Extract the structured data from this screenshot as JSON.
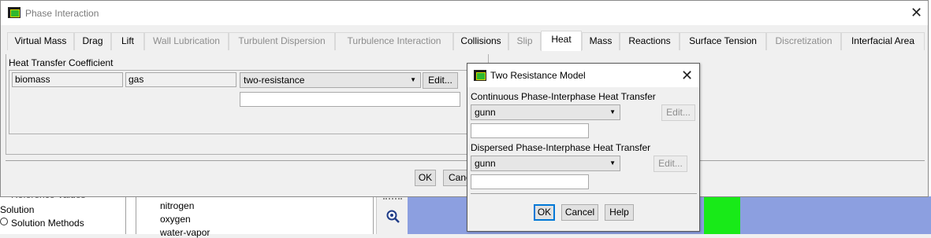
{
  "background": {
    "tree": [
      "Reference Values",
      "Solution",
      "Solution Methods"
    ],
    "species": [
      "nitrogen",
      "oxygen",
      "water-vapor"
    ],
    "zoom_icon": "magnifier-icon"
  },
  "main_dialog": {
    "title": "Phase Interaction",
    "tabs": [
      {
        "label": "Virtual Mass",
        "disabled": false
      },
      {
        "label": "Drag",
        "disabled": false
      },
      {
        "label": "Lift",
        "disabled": false
      },
      {
        "label": "Wall Lubrication",
        "disabled": true
      },
      {
        "label": "Turbulent Dispersion",
        "disabled": true
      },
      {
        "label": "Turbulence Interaction",
        "disabled": true
      },
      {
        "label": "Collisions",
        "disabled": false
      },
      {
        "label": "Slip",
        "disabled": true
      },
      {
        "label": "Heat",
        "disabled": false,
        "active": true
      },
      {
        "label": "Mass",
        "disabled": false
      },
      {
        "label": "Reactions",
        "disabled": false
      },
      {
        "label": "Surface Tension",
        "disabled": false
      },
      {
        "label": "Discretization",
        "disabled": true
      },
      {
        "label": "Interfacial Area",
        "disabled": false
      }
    ],
    "group_title": "Heat Transfer Coefficient",
    "phase_1": "biomass",
    "phase_2": "gas",
    "model_value": "two-resistance",
    "edit_label": "Edit...",
    "extra_value": "",
    "ok_label": "OK",
    "cancel_label": "Cancel"
  },
  "two_resistance": {
    "title": "Two Resistance Model",
    "continuous_label": "Continuous Phase-Interphase Heat Transfer",
    "continuous_value": "gunn",
    "continuous_edit": "Edit...",
    "continuous_input": "",
    "dispersed_label": "Dispersed Phase-Interphase Heat Transfer",
    "dispersed_value": "gunn",
    "dispersed_edit": "Edit...",
    "dispersed_input": "",
    "ok_label": "OK",
    "cancel_label": "Cancel",
    "help_label": "Help"
  },
  "colors": {
    "accent": "#0078d7",
    "viewport": "#8c9fe0",
    "highlight": "#18ea18"
  }
}
